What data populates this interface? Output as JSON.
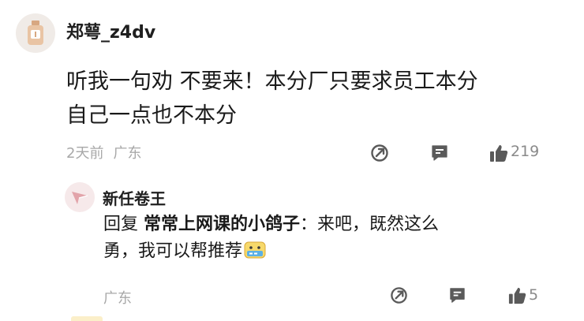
{
  "comment": {
    "username": "郑萼_z4dv",
    "text_line1": "听我一句劝 不要来！本分厂只要求员工本分",
    "text_line2": "自己一点也不本分",
    "time": "2天前",
    "location": "广东",
    "like_count": "219"
  },
  "reply": {
    "username": "新任卷王",
    "reply_prefix": "回复",
    "mention": "常常上网课的小鸽子",
    "colon": "：",
    "text_part1": "来吧，既然这么",
    "text_part2": "勇，我可以帮推荐",
    "location": "广东",
    "like_count": "5"
  },
  "icons": {
    "share": "share-icon",
    "comment": "comment-icon",
    "like": "thumbs-up-icon",
    "emoji": "emoji-sticker-icon"
  },
  "colors": {
    "icon": "#5a5a5a",
    "meta": "#a8a8a8",
    "avatar_bg": "#f0ebe7",
    "reply_avatar_bg": "#f6e9ea",
    "reply_avatar_accent": "#e2a4aa"
  }
}
